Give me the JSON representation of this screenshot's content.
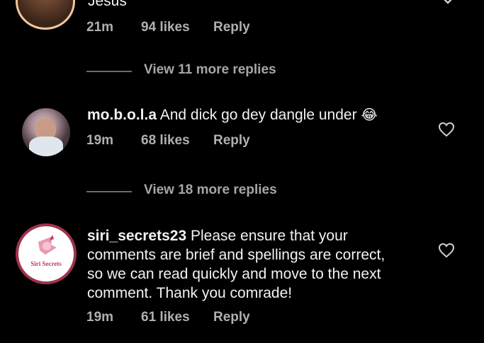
{
  "comments": [
    {
      "text": "Jesus",
      "time": "21m",
      "likes": "94 likes",
      "reply": "Reply"
    },
    {
      "username": "mo.b.o.l.a",
      "text": "And dick go dey dangle under",
      "emoji": "😂",
      "time": "19m",
      "likes": "68 likes",
      "reply": "Reply"
    },
    {
      "username": "siri_secrets23",
      "text_lines": [
        "Please ensure that your",
        "comments are brief and spellings are correct,",
        "so we can read quickly and move to the next",
        "comment. Thank you comrade!"
      ],
      "avatar_logo_text": "Siri Secrets",
      "time": "19m",
      "likes": "61 likes",
      "reply": "Reply"
    }
  ],
  "view_replies": [
    "View 11 more replies",
    "View 18 more replies"
  ],
  "colors": {
    "background": "#000000",
    "text": "#f2f2f2",
    "meta": "#b0b0b0",
    "ring": "#f2c59a"
  }
}
